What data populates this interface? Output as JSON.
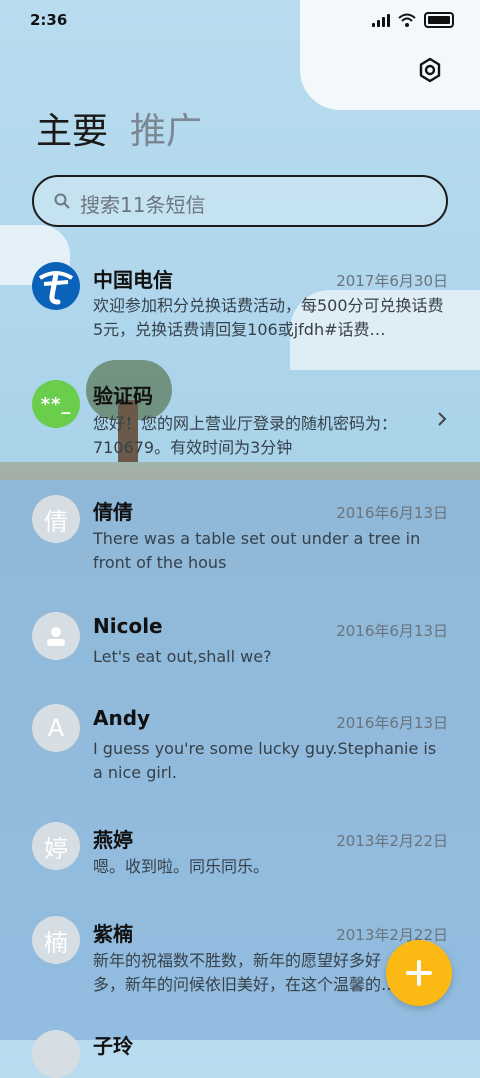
{
  "status_bar": {
    "time": "2:36"
  },
  "tabs": [
    {
      "label": "主要",
      "active": true
    },
    {
      "label": "推广",
      "active": false
    }
  ],
  "search": {
    "placeholder": "搜索11条短信"
  },
  "conversations": [
    {
      "name": "中国电信",
      "date": "2017年6月30日",
      "preview": "欢迎参加积分兑换话费活动，每500分可兑换话费5元，兑换话费请回复106或jfdh#话费…",
      "avatar": "telecom-logo"
    },
    {
      "name": "验证码",
      "date": "",
      "preview": "您好！您的网上营业厅登录的随机密码为：710679。有效时间为3分钟",
      "avatar_text": "**_"
    },
    {
      "name": "倩倩",
      "date": "2016年6月13日",
      "preview": "There was a table set out under a tree in front of the hous",
      "avatar_text": "倩"
    },
    {
      "name": "Nicole",
      "date": "2016年6月13日",
      "preview": "Let's eat out,shall we?",
      "avatar": "person-icon"
    },
    {
      "name": "Andy",
      "date": "2016年6月13日",
      "preview": "I guess you're some lucky guy.Stephanie is a nice girl.",
      "avatar_text": "A"
    },
    {
      "name": "燕婷",
      "date": "2013年2月22日",
      "preview": "嗯。收到啦。同乐同乐。",
      "avatar_text": "婷"
    },
    {
      "name": "紫楠",
      "date": "2013年2月22日",
      "preview": "新年的祝福数不胜数，新年的愿望好多好多，新年的问候依旧美好，在这个温馨的时刻",
      "avatar_text": "楠"
    },
    {
      "name": "子玲",
      "date": "",
      "preview": "",
      "avatar_text": ""
    }
  ],
  "colors": {
    "fab": "#fdb913",
    "verify_avatar": "#6acd4c",
    "telecom_blue": "#0a63b8"
  }
}
